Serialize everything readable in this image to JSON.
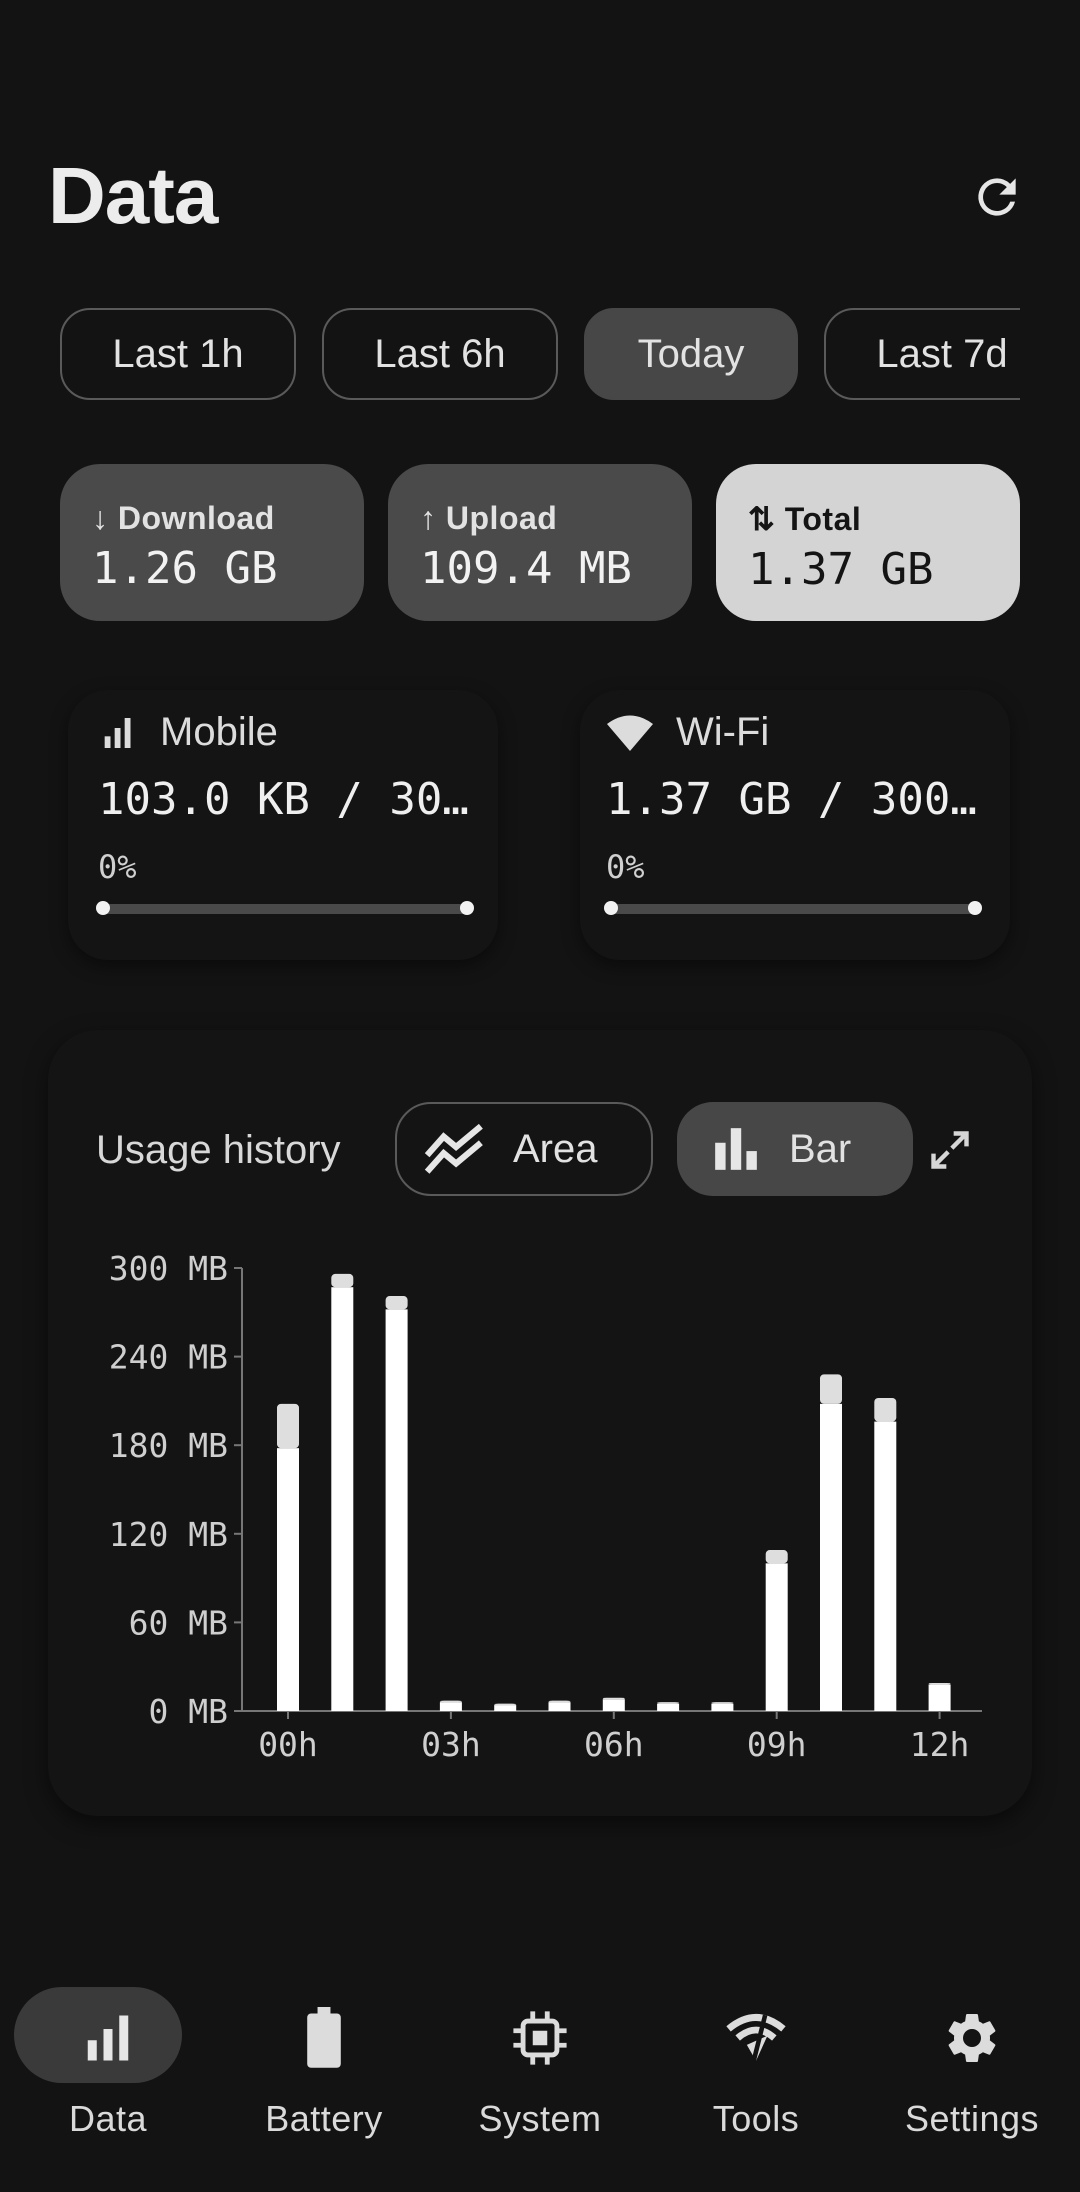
{
  "header": {
    "title": "Data"
  },
  "ranges": [
    {
      "label": "Last 1h",
      "active": false
    },
    {
      "label": "Last 6h",
      "active": false
    },
    {
      "label": "Today",
      "active": true
    },
    {
      "label": "Last 7d",
      "active": false
    }
  ],
  "stats": {
    "download": {
      "label": "↓ Download",
      "value": "1.26 GB"
    },
    "upload": {
      "label": "↑ Upload",
      "value": "109.4 MB"
    },
    "total": {
      "label": "⇅ Total",
      "value": "1.37 GB"
    }
  },
  "networks": {
    "mobile": {
      "name": "Mobile",
      "amount": "103.0 KB / 30…",
      "percent": "0%",
      "progress": 0
    },
    "wifi": {
      "name": "Wi-Fi",
      "amount": "1.37 GB / 300…",
      "percent": "0%",
      "progress": 0
    }
  },
  "history": {
    "label": "Usage history",
    "area_label": "Area",
    "bar_label": "Bar"
  },
  "chart_data": {
    "type": "bar",
    "stacked": true,
    "y_unit": "MB",
    "ylim": [
      0,
      300
    ],
    "y_ticks": [
      "300 MB",
      "240 MB",
      "180 MB",
      "120 MB",
      "60 MB",
      "0 MB"
    ],
    "y_tick_values": [
      300,
      240,
      180,
      120,
      60,
      0
    ],
    "x_ticks": [
      "00h",
      "03h",
      "06h",
      "09h",
      "12h"
    ],
    "categories": [
      "00h",
      "01h",
      "02h",
      "03h",
      "04h",
      "05h",
      "06h",
      "07h",
      "08h",
      "09h",
      "10h",
      "11h",
      "12h"
    ],
    "series": [
      {
        "values": [
          178,
          287,
          272,
          6,
          4,
          6,
          8,
          5,
          5,
          100,
          208,
          196,
          18
        ]
      },
      {
        "values": [
          30,
          9,
          9,
          1,
          1,
          1,
          1,
          1,
          1,
          9,
          20,
          16,
          1
        ]
      }
    ],
    "colors": [
      "#ffffff",
      "#dedede"
    ],
    "grid": false
  },
  "nav": [
    {
      "label": "Data",
      "icon": "bar-chart-icon",
      "active": true
    },
    {
      "label": "Battery",
      "icon": "battery-icon",
      "active": false
    },
    {
      "label": "System",
      "icon": "chip-icon",
      "active": false
    },
    {
      "label": "Tools",
      "icon": "tools-icon",
      "active": false
    },
    {
      "label": "Settings",
      "icon": "gear-icon",
      "active": false
    }
  ]
}
